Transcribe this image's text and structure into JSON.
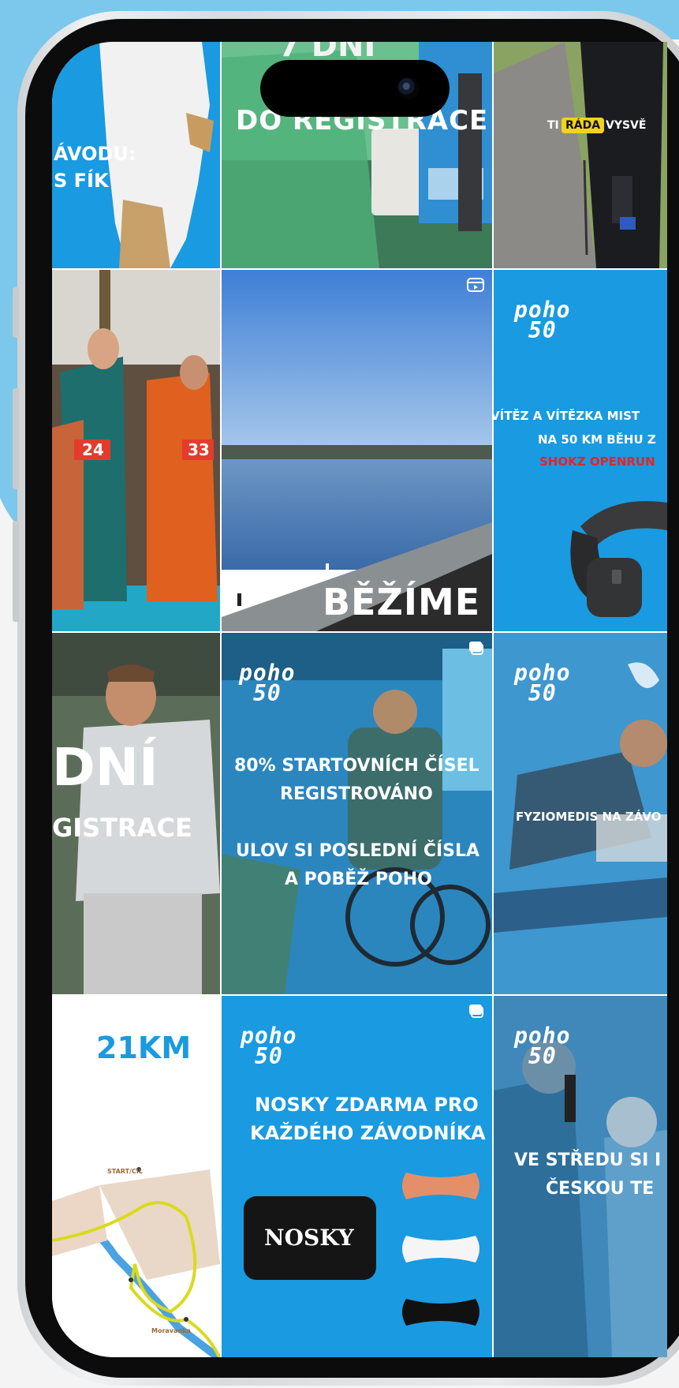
{
  "posts": {
    "p1": {
      "text_line1": "ÁVODU:",
      "text_line2": "S FÍK"
    },
    "p2": {
      "heading": "DO REGISTRACE",
      "partial_top": "7 DNÍ"
    },
    "p3": {
      "highlight": "RÁDA",
      "prefix": "TI",
      "suffix": "VYSVĚ"
    },
    "p4": {
      "bib1": "24",
      "bib2": "33"
    },
    "p5": {
      "caption": "BĚŽÍME",
      "badge_icon": "reel-icon"
    },
    "p6": {
      "logo": [
        "poho",
        "50"
      ],
      "line1": "VÍTĚZ A VÍTĚZKA MIST",
      "line2": "NA 50 KM BĚHU Z",
      "line3": "SHOKZ OPENRUN"
    },
    "p7": {
      "big": "DNÍ",
      "line": "GISTRACE"
    },
    "p8": {
      "logo": [
        "poho",
        "50"
      ],
      "line1": "80% STARTOVNÍCH ČÍSEL",
      "line2": "REGISTROVÁNO",
      "line3": "ULOV SI POSLEDNÍ ČÍSLA",
      "line4": "A POBĚŽ POHO",
      "badge_icon": "carousel-icon"
    },
    "p9": {
      "logo": [
        "poho",
        "50"
      ],
      "line1": "FYZIOMEDIS NA ZÁVO"
    },
    "p10": {
      "title": "21KM",
      "map_labels": [
        "START/CÍL",
        "Moravanka"
      ]
    },
    "p11": {
      "logo": [
        "poho",
        "50"
      ],
      "line1": "NOSKY ZDARMA PRO",
      "line2": "KAŽDÉHO ZÁVODNÍKA",
      "product": "NOSKY",
      "badge_icon": "carousel-icon"
    },
    "p12": {
      "logo": [
        "poho",
        "50"
      ],
      "line1": "VE STŘEDU SI I",
      "line2": "ČESKOU TE"
    }
  },
  "colors": {
    "brand_blue": "#1a9ae0",
    "accent_red": "#e6222a",
    "highlight_yellow": "#f3d21a",
    "route_yellow": "#dada1f"
  }
}
